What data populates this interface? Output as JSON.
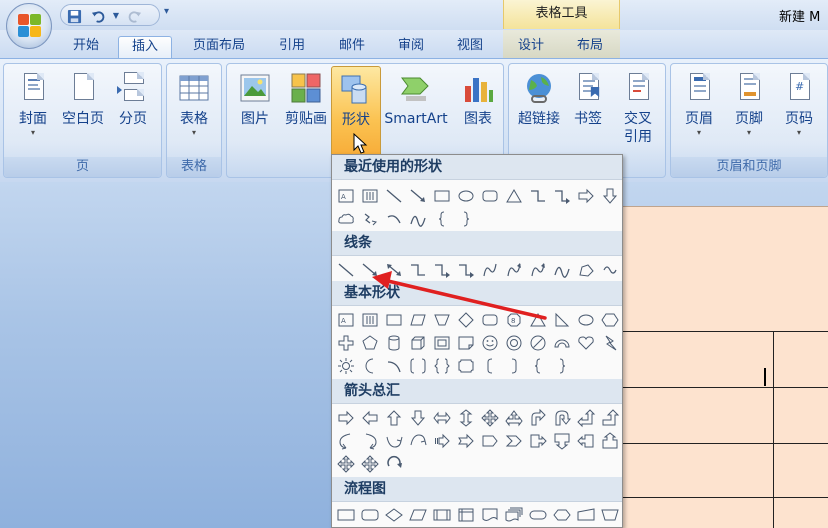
{
  "titlebar": {
    "context_tab_group": "表格工具",
    "doc_title": "新建 M"
  },
  "qat": {
    "save_icon": "save-icon",
    "undo_icon": "undo-icon",
    "redo_icon": "redo-icon",
    "more_icon": "chevron-down-icon"
  },
  "tabs": {
    "home": "开始",
    "insert": "插入",
    "page_layout": "页面布局",
    "references": "引用",
    "mailings": "邮件",
    "review": "审阅",
    "view": "视图",
    "design": "设计",
    "layout": "布局"
  },
  "ribbon": {
    "pages": {
      "label": "页",
      "cover": "封面",
      "blank": "空白页",
      "page_break": "分页"
    },
    "tables": {
      "label": "表格",
      "table": "表格"
    },
    "illustrations": {
      "picture": "图片",
      "clipart": "剪贴画",
      "shapes": "形状",
      "smartart": "SmartArt",
      "chart": "图表"
    },
    "links": {
      "hyperlink": "超链接",
      "bookmark": "书签",
      "crossref_line1": "交叉",
      "crossref_line2": "引用"
    },
    "header_footer": {
      "label": "页眉和页脚",
      "header": "页眉",
      "footer": "页脚",
      "page_number": "页码"
    }
  },
  "gallery": {
    "recent": "最近使用的形状",
    "lines": "线条",
    "basic": "基本形状",
    "arrows": "箭头总汇",
    "flowchart": "流程图"
  },
  "colors": {
    "ribbon_text": "#15428b",
    "pressed": "#fbc352",
    "annotation_arrow": "#e02020",
    "page_bg": "#fde3cf"
  }
}
